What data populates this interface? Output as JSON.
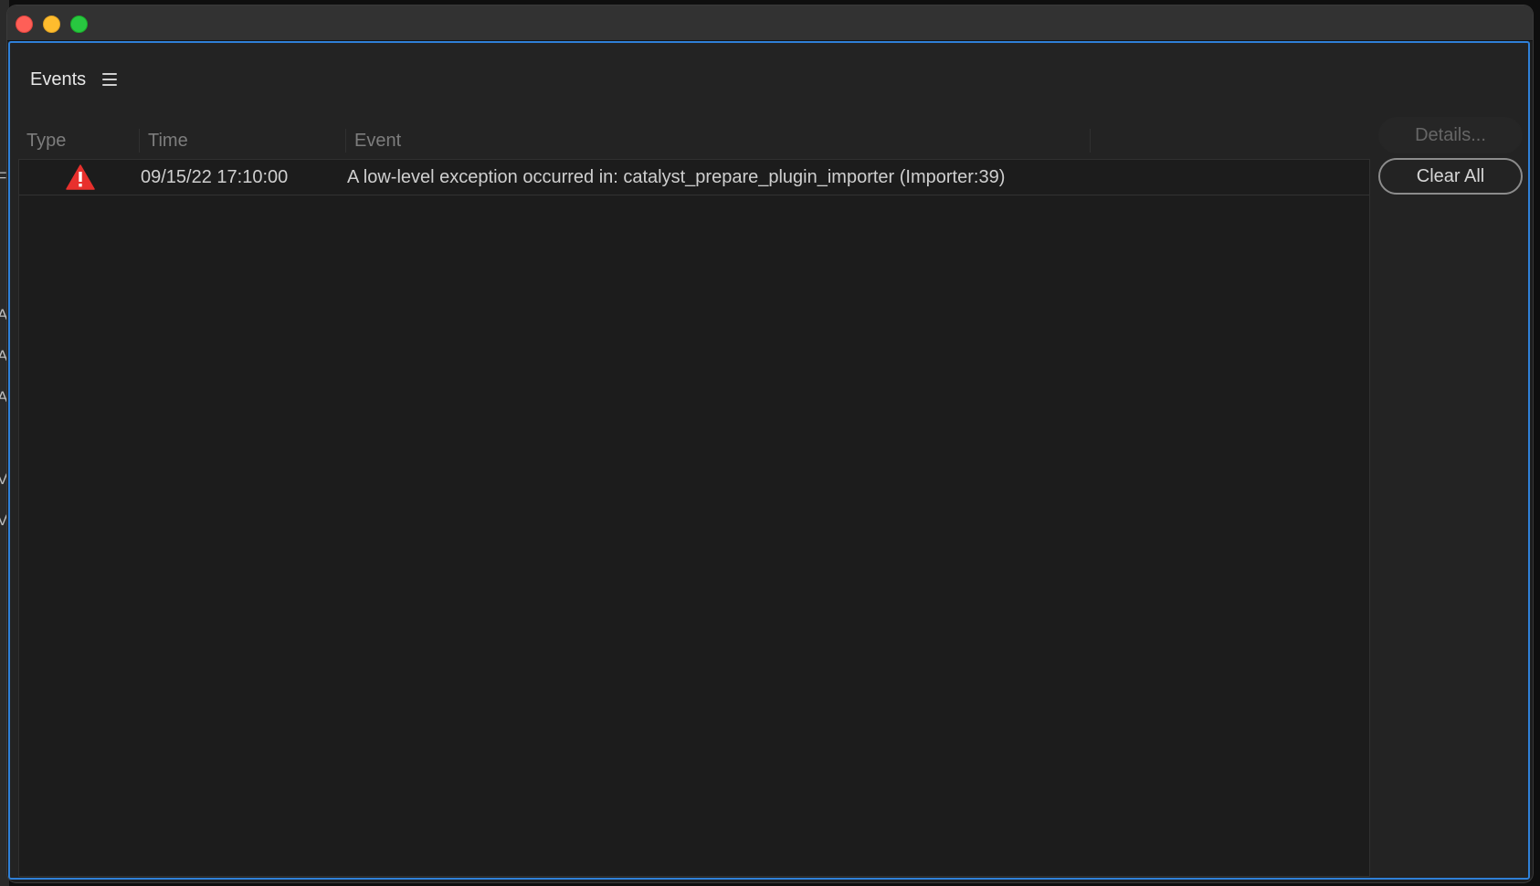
{
  "window": {
    "controls": [
      "close",
      "minimize",
      "maximize"
    ]
  },
  "panel": {
    "title": "Events",
    "menu_icon": "hamburger-menu-icon"
  },
  "table": {
    "columns": [
      "Type",
      "Time",
      "Event"
    ],
    "rows": [
      {
        "type_icon": "warning-icon",
        "type_color": "#e8302d",
        "time": "09/15/22 17:10:00",
        "event": "A low-level exception occurred in: catalyst_prepare_plugin_importer (Importer:39)"
      }
    ]
  },
  "buttons": {
    "details": "Details...",
    "clear_all": "Clear All"
  },
  "colors": {
    "accent_border": "#2f80d8",
    "panel_bg": "#232323",
    "list_bg": "#1c1c1c"
  }
}
